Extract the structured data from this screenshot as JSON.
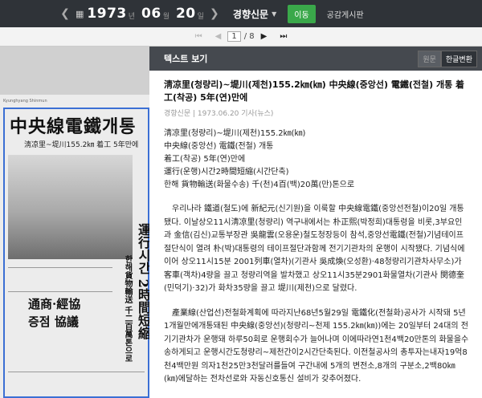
{
  "topbar": {
    "prev_icon": "chevron-left-icon",
    "calendar_icon": "calendar-icon",
    "year": "1973",
    "year_unit": "년",
    "month": "06",
    "month_unit": "월",
    "day": "20",
    "day_unit": "일",
    "next_icon": "chevron-right-icon",
    "newspaper": "경향신문",
    "go_label": "이동",
    "share_label": "공감게시판"
  },
  "pager": {
    "current": "1",
    "total": "/ 8"
  },
  "paper": {
    "masthead": "Kyunghyang Shinmun",
    "headline": "中央線電鐵개통",
    "subheadline": "淸凉里~堤川155.2㎞ 着工 5年만에",
    "vertical_1": "運行시간 2時間短縮",
    "vertical_2": "한해貨物輸送 千二百萬톤으로",
    "box_lines": [
      "通商·經協",
      "증점 協議"
    ]
  },
  "viewer": {
    "header": "텍스트 보기",
    "tab_original": "원문",
    "tab_hangul": "한글변환",
    "article_title": "淸凉里(청량리)~堤川(제천)155.2㎞(㎞) 中央線(중앙선) 電鐵(전철) 개통 着工(착공) 5年(연)만에",
    "source": "경향신문 | 1973.06.20 기사(뉴스)",
    "summary": [
      "淸凉里(청량리)~堤川(제천)155.2㎞(㎞)",
      "中央線(중앙선) 電鐵(전철) 개통",
      "着工(착공) 5年(연)만에",
      "運行(운행)시간2時間短縮(시간단축)",
      "한해 貨物輸送(화물수송) 千(천)4百(백)20萬(만)톤으로"
    ],
    "paragraph_1": "우리나라 鐵道(철도)에 新紀元(신기원)을 이룩할 中央線電鐵(중앙선전철)이20일 개통됐다. 이날상오11시淸凉里(청량리) 역구내에서는 朴正熙(박정희)대통령을 비롯,3부요인과 金信(김신)교통부장관 吳龍雲(오용운)철도청장등이 참석,중앙선電鐵(전철)기념테이프절단식이 열려 朴(박)대통령의 테이프절단과함께 전기기관차의 운행이 시작됐다. 기념식에 이어 상오11시15분 2001列車(열차)(기관사 吳成煥(오성환)·48청량리기관차사무소)가 客車(객차)4량을 끌고 청량리역을 발차했고 상오11시35분2901화물열차(기관사 閔德奎(민덕기)·32)가 화차35량을 끌고 堤川(제천)으로 달렸다.",
    "paragraph_2": "產業線(산업선)전철화계획에 따라지난68년5월29일 電鐵化(전철화)공사가 시작돼 5년1개월만에개통돼된 中央線(중앙선)(청량리~천제 155.2㎞(㎞))에는 20일부터 24대의 전기기관차가 운행돼 하루50회로 운행회수가 늘어나며 이에따라연1천4백20만톤의 화물을수송하게되고 운행시간도청량리~제천간이2시간단축된다. 이전철공사의 총투자는내자19억8천4백만원 의자1천25만3천달러를들여 구간내에 5개의 변전소,8개의 구분소,2백80㎞(㎞)에달하는 전차선로와 자동신호통신 설비가 갖추어졌다."
  }
}
